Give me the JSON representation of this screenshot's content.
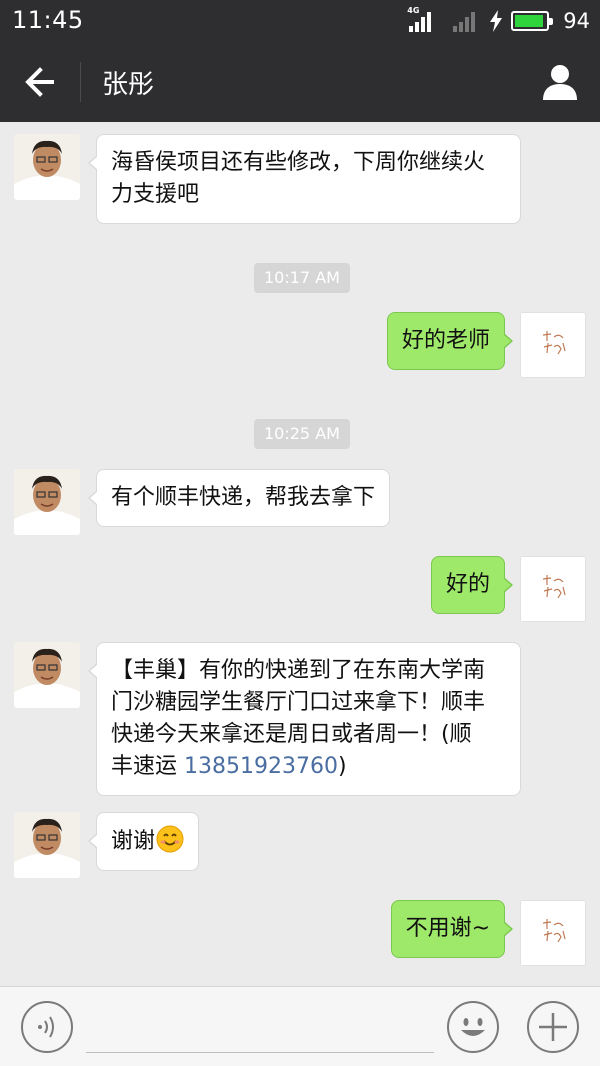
{
  "status_bar": {
    "time": "11:45",
    "network": "4G",
    "battery": "94",
    "battery_level": 0.94
  },
  "header": {
    "title": "张彤",
    "back_icon": "back-arrow-icon",
    "profile_icon": "person-icon"
  },
  "messages": [
    {
      "side": "left",
      "text_line1": "海昏侯项目还有些修改，下周你继续火",
      "text_line2": "力支援吧"
    },
    {
      "timestamp": "10:17 AM"
    },
    {
      "side": "right",
      "text": "好的老师"
    },
    {
      "timestamp": "10:25 AM"
    },
    {
      "side": "left",
      "text": "有个顺丰快递，帮我去拿下"
    },
    {
      "side": "right",
      "text": "好的"
    },
    {
      "side": "left",
      "line1": "【丰巢】有你的快递到了在东南大学南",
      "line2": "门沙糖园学生餐厅门口过来拿下！顺丰",
      "line3": "快递今天来拿还是周日或者周一！(顺",
      "line4_prefix": "丰速运 ",
      "phone": "13851923760",
      "line4_suffix": ")"
    },
    {
      "side": "left",
      "text": "谢谢",
      "emoji": "smiling-face-emoji"
    },
    {
      "side": "right",
      "text": "不用谢~"
    }
  ],
  "input_bar": {
    "placeholder": "",
    "voice_icon": "voice-icon",
    "emoji_icon": "emoji-icon",
    "plus_icon": "plus-icon"
  },
  "colors": {
    "header_bg": "#2e2e30",
    "chat_bg": "#ebebeb",
    "sent_bubble": "#9ee86a",
    "received_bubble": "#ffffff",
    "link": "#4a6ea1"
  }
}
